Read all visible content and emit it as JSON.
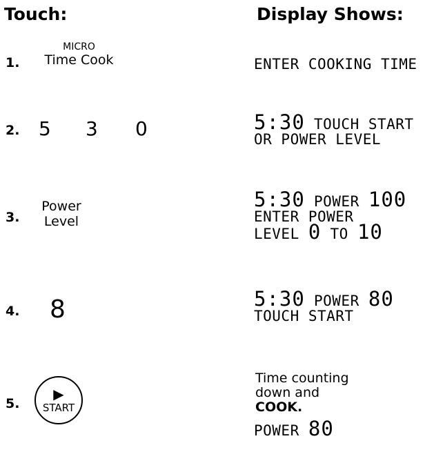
{
  "headers": {
    "touch": "Touch:",
    "display": "Display Shows:"
  },
  "steps": [
    {
      "number": "1.",
      "key_top": "MICRO",
      "key_bottom": "Time Cook",
      "display_line1": "ENTER COOKING TIME"
    },
    {
      "number": "2.",
      "digits": [
        "5",
        "3",
        "0"
      ],
      "display_time": "5:30",
      "display_line1": "TOUCH START",
      "display_line2": "OR POWER LEVEL"
    },
    {
      "number": "3.",
      "key_line1": "Power",
      "key_line2": "Level",
      "display_time": "5:30",
      "display_label": "POWER",
      "display_value": "100",
      "display_line2": "ENTER POWER",
      "display_line3_a": "LEVEL",
      "display_line3_b": "0",
      "display_line3_c": "TO",
      "display_line3_d": "10"
    },
    {
      "number": "4.",
      "digit": "8",
      "display_time": "5:30",
      "display_label": "POWER",
      "display_value": "80",
      "display_line2": "TOUCH START"
    },
    {
      "number": "5.",
      "button_icon": "play-icon",
      "button_label": "START",
      "text_line1": "Time counting",
      "text_line2": "down and",
      "text_line3": "COOK.",
      "display_label": "POWER",
      "display_value": "80"
    }
  ]
}
